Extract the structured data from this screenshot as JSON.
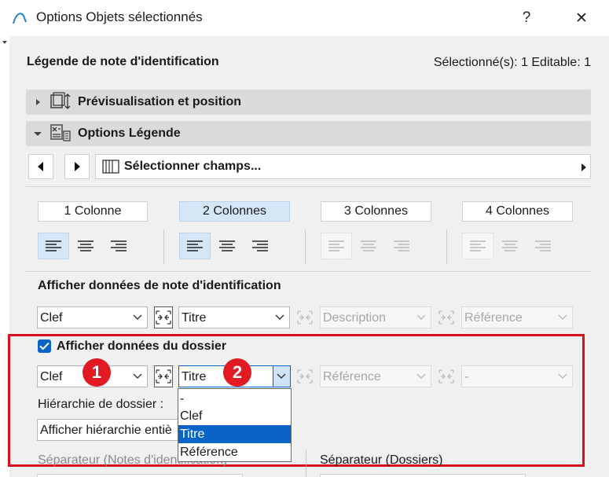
{
  "window": {
    "title": "Options Objets sélectionnés",
    "help_label": "?",
    "close_label": "✕"
  },
  "header": {
    "title": "Légende de note d'identification",
    "status": "Sélectionné(s): 1 Editable: 1"
  },
  "sections": {
    "preview_label": "Prévisualisation et position",
    "options_label": "Options Légende"
  },
  "field_selector": {
    "label": "Sélectionner champs..."
  },
  "columns": [
    {
      "label": "1 Colonne",
      "active": false
    },
    {
      "label": "2 Colonnes",
      "active": true
    },
    {
      "label": "3 Colonnes",
      "active": false
    },
    {
      "label": "4 Colonnes",
      "active": false
    }
  ],
  "note_data": {
    "title": "Afficher données de note d'identification",
    "fields": [
      "Clef",
      "Titre",
      "Description",
      "Référence"
    ]
  },
  "folder_data": {
    "title": "Afficher données du dossier",
    "checked": true,
    "fields": [
      "Clef",
      "Titre",
      "Référence",
      "-"
    ],
    "hierarchy_label": "Hiérarchie de dossier :",
    "hierarchy_value": "Afficher hiérarchie entiè"
  },
  "dropdown": {
    "options": [
      "-",
      "Clef",
      "Titre",
      "Référence"
    ],
    "selected_index": 2
  },
  "badges": {
    "one": "1",
    "two": "2"
  },
  "footer": {
    "sep_notes": "Séparateur (Notes d'identification)",
    "sep_folders": "Séparateur (Dossiers)"
  },
  "colors": {
    "accent": "#0a64c8",
    "annotation_red": "#d80f1d",
    "active_tab": "#d5e6f6"
  }
}
